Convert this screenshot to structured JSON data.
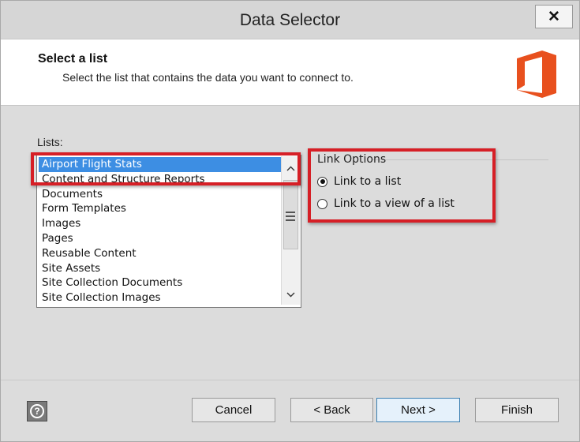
{
  "window": {
    "title": "Data Selector",
    "close_glyph": "✕"
  },
  "header": {
    "title": "Select a list",
    "subtitle": "Select the list that contains the data you want to connect to.",
    "logo_icon": "office-logo-icon",
    "logo_color": "#e8501e"
  },
  "lists": {
    "label": "Lists:",
    "selected_index": 0,
    "items": [
      "Airport Flight Stats",
      "Content and Structure Reports",
      "Documents",
      "Form Templates",
      "Images",
      "Pages",
      "Reusable Content",
      "Site Assets",
      "Site Collection Documents",
      "Site Collection Images"
    ]
  },
  "link_options": {
    "legend": "Link Options",
    "options": [
      {
        "label": "Link to a list",
        "checked": true
      },
      {
        "label": "Link to a view of a list",
        "checked": false
      }
    ]
  },
  "highlight_color": "#d61f26",
  "buttons": {
    "cancel": "Cancel",
    "back": "< Back",
    "next": "Next >",
    "finish": "Finish"
  },
  "help_icon": "help-icon"
}
